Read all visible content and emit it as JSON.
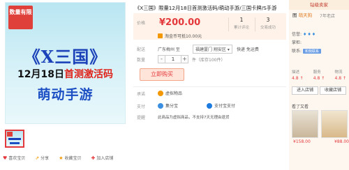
{
  "main_image": {
    "badge": "数量有限",
    "title": "《X三国》",
    "date_black": "12月18日",
    "date_red": "首测激活码",
    "game_line": "萌动手游"
  },
  "actions": [
    {
      "icon": "heart-icon",
      "label": "喜欢宝贝"
    },
    {
      "icon": "share-icon",
      "label": "分享"
    },
    {
      "icon": "star-icon",
      "label": "收藏宝贝"
    },
    {
      "icon": "plus-icon",
      "label": "加入店铺"
    }
  ],
  "product": {
    "title": "《X三国》限量12月18日首测激活码/萌动手游/三国卡牌/S手游",
    "price_label": "价格",
    "price": "¥200.00",
    "stats": [
      {
        "value": "1",
        "label": "累计评论"
      },
      {
        "value": "3",
        "label": "交易成功"
      }
    ],
    "promo": "淘金币可抵10.00元",
    "ship_label": "配送",
    "ship_from": "广东梅州 至",
    "ship_to": "福建厦门 翔安区 ▾",
    "ship_fee": "快递 免运费",
    "qty_label": "数量",
    "qty_minus": "-",
    "qty_value": "1",
    "qty_plus": "+",
    "stock": "件（库存100件）",
    "buy_label": "立即购买",
    "services": [
      {
        "label": "承诺",
        "text": "虚拟物品",
        "color": "#f39800"
      },
      {
        "label": "支付",
        "text": "集分宝",
        "color": "#3a8fe0",
        "text2": "支付宝支付",
        "color2": "#1d7be0"
      },
      {
        "label": "提醒",
        "text": "此商品为虚拟商品，不支持7天无理由退货"
      }
    ]
  },
  "shop": {
    "header": "钻级卖家",
    "name": "图 ",
    "name_hl": "萌天狗",
    "years": "7年老店",
    "credit_label": "信誉:",
    "credit_icons": "♦♦♦",
    "boss_label": "掌柜:",
    "contact_label": "联系:",
    "contact_badge": "和我联系",
    "scores": [
      {
        "label": "描述",
        "value": "4.8 ↑"
      },
      {
        "label": "服务",
        "value": "4.8 ↑"
      },
      {
        "label": "物流",
        "value": "4.8 ↑"
      }
    ],
    "enter_btn": "进入店铺",
    "fav_btn": "收藏店铺",
    "sub_title": "看了又看",
    "thumb_prices": [
      "¥158.00",
      "¥88.00"
    ]
  },
  "colors": {
    "accent": "#e4393c",
    "price_bg": "#fff2e8",
    "blue_text": "#1b42b8"
  }
}
